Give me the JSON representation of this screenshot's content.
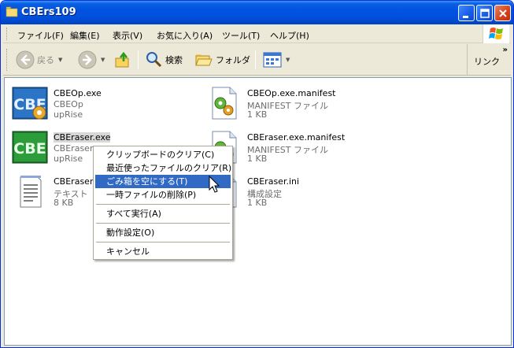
{
  "window": {
    "title": "CBErs109"
  },
  "menubar": {
    "items": [
      "ファイル(F)",
      "編集(E)",
      "表示(V)",
      "お気に入り(A)",
      "ツール(T)",
      "ヘルプ(H)"
    ]
  },
  "toolbar": {
    "back_label": "戻る",
    "search_label": "検索",
    "folders_label": "フォルダ",
    "links_label": "リンク",
    "chevron": "»"
  },
  "files": [
    {
      "name": "CBEOp.exe",
      "line2": "CBEOp",
      "line3": "upRise",
      "icon": "cbe-app-icon"
    },
    {
      "name": "CBEOp.exe.manifest",
      "line2": "MANIFEST ファイル",
      "line3": "1 KB",
      "icon": "manifest-file-icon"
    },
    {
      "name": "CBEraser.exe",
      "line2": "CBEraser",
      "line3": "upRise",
      "icon": "cbe-app-icon"
    },
    {
      "name": "CBEraser.exe.manifest",
      "line2": "MANIFEST ファイル",
      "line3": "1 KB",
      "icon": "manifest-file-icon"
    },
    {
      "name": "CBEraser.",
      "line2": "テキスト ド",
      "line3": "8 KB",
      "icon": "text-file-icon"
    },
    {
      "name": "CBEraser.ini",
      "line2": "構成設定",
      "line3": "1 KB",
      "icon": "ini-file-icon"
    }
  ],
  "context_menu": {
    "items": [
      "クリップボードのクリア(C)",
      "最近使ったファイルのクリア(R)",
      "ごみ箱を空にする(T)",
      "一時ファイルの削除(P)",
      "すべて実行(A)",
      "動作設定(O)",
      "キャンセル"
    ],
    "highlighted_index": 2
  },
  "colors": {
    "title_bar": "#0053E1",
    "menu_highlight": "#316AC5",
    "content_bg": "#FFFFFF",
    "chrome_bg": "#ECE9D8"
  }
}
